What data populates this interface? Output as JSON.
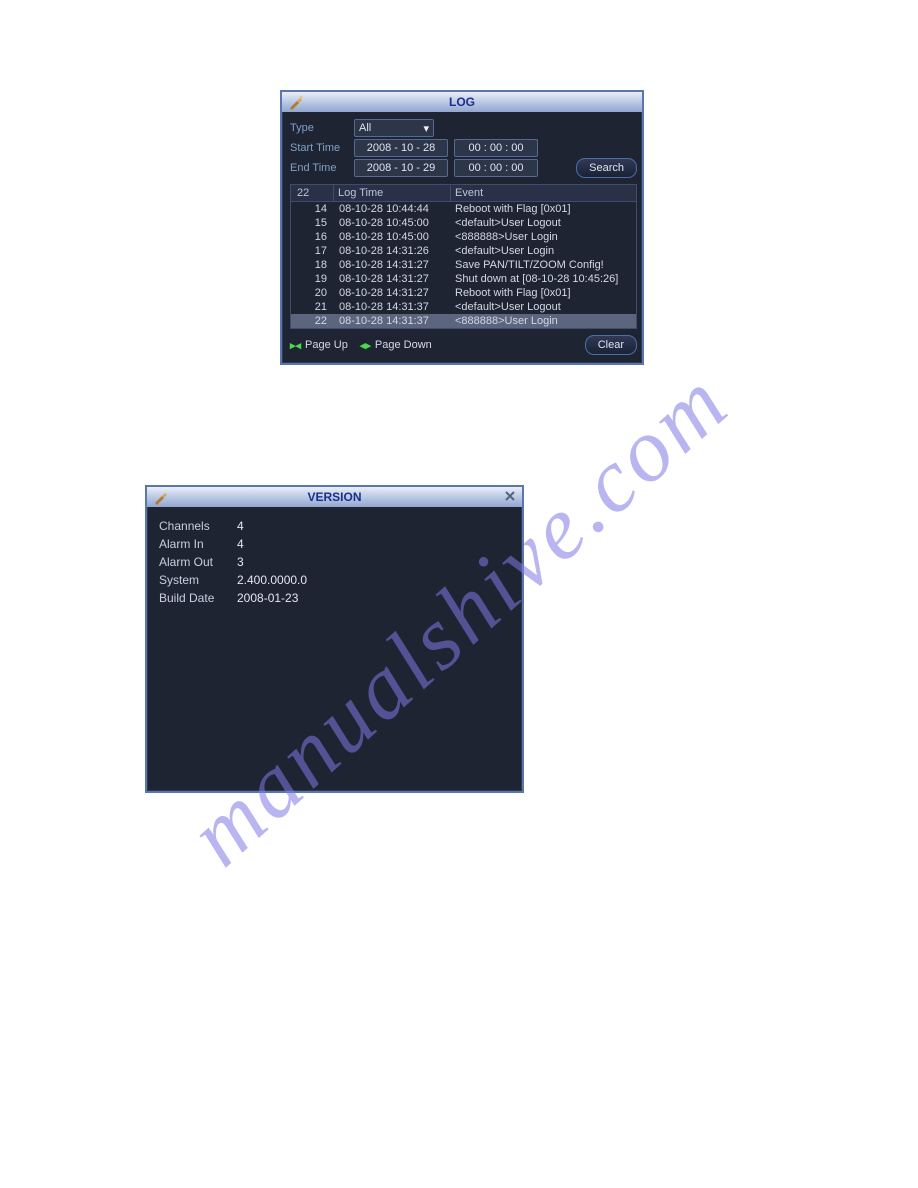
{
  "watermark": "manualshive.com",
  "log": {
    "title": "LOG",
    "type_label": "Type",
    "type_value": "All",
    "start_label": "Start Time",
    "start_date": "2008 - 10 - 28",
    "start_time": "00 : 00 : 00",
    "end_label": "End Time",
    "end_date": "2008 - 10 - 29",
    "end_time": "00 : 00 : 00",
    "search_label": "Search",
    "count": "22",
    "header_time": "Log Time",
    "header_event": "Event",
    "rows": [
      {
        "idx": "14",
        "time": "08-10-28 10:44:44",
        "event": "Reboot with Flag [0x01]"
      },
      {
        "idx": "15",
        "time": "08-10-28 10:45:00",
        "event": "<default>User Logout"
      },
      {
        "idx": "16",
        "time": "08-10-28 10:45:00",
        "event": "<888888>User Login"
      },
      {
        "idx": "17",
        "time": "08-10-28 14:31:26",
        "event": "<default>User Login"
      },
      {
        "idx": "18",
        "time": "08-10-28 14:31:27",
        "event": "Save PAN/TILT/ZOOM Config!"
      },
      {
        "idx": "19",
        "time": "08-10-28 14:31:27",
        "event": "Shut down at [08-10-28 10:45:26]"
      },
      {
        "idx": "20",
        "time": "08-10-28 14:31:27",
        "event": "Reboot with Flag [0x01]"
      },
      {
        "idx": "21",
        "time": "08-10-28 14:31:37",
        "event": "<default>User Logout"
      },
      {
        "idx": "22",
        "time": "08-10-28 14:31:37",
        "event": "<888888>User Login",
        "selected": true
      }
    ],
    "pageup": "Page Up",
    "pagedown": "Page Down",
    "clear": "Clear"
  },
  "version": {
    "title": "VERSION",
    "rows": [
      {
        "k": "Channels",
        "v": "4"
      },
      {
        "k": "Alarm In",
        "v": "4"
      },
      {
        "k": "Alarm Out",
        "v": "3"
      },
      {
        "k": "System",
        "v": "2.400.0000.0"
      },
      {
        "k": "Build Date",
        "v": "2008-01-23"
      }
    ]
  }
}
